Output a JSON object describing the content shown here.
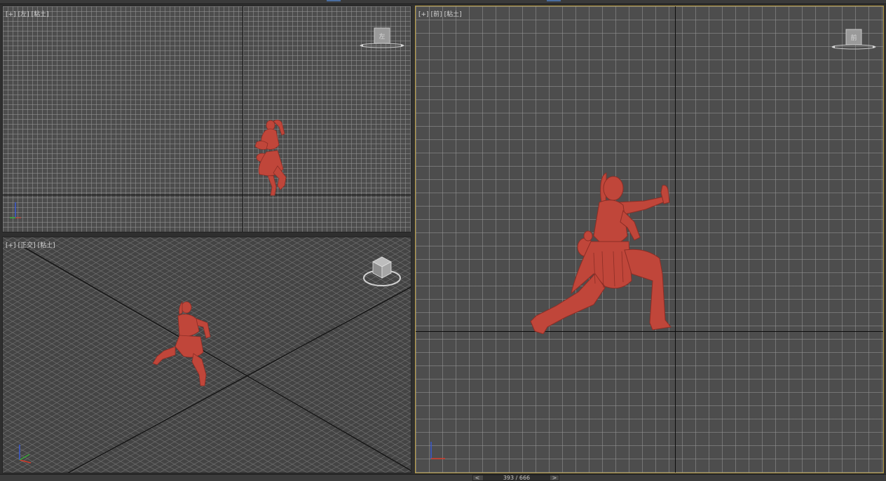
{
  "viewports": {
    "left": {
      "labels": [
        "[+]",
        "[左]",
        "[粘土]"
      ],
      "cube_face": "左"
    },
    "perspective": {
      "labels": [
        "[+]",
        "[正交]",
        "[粘土]"
      ]
    },
    "front": {
      "labels": [
        "[+]",
        "[前]",
        "[粘土]"
      ],
      "cube_face": "前"
    }
  },
  "timeline": {
    "prev": "<",
    "next": ">",
    "frame": "393 / 666",
    "current_frame": 393,
    "total_frames": 666
  },
  "colors": {
    "model": "#c0463a",
    "viewport_bg": "#4d4d4d",
    "grid_line": "#969696",
    "active_border": "#b79b40",
    "axis_x": "#d23a2a",
    "axis_y": "#3aaa3a",
    "axis_z": "#3a5ad2"
  },
  "icons": {
    "viewcube": "viewcube-icon",
    "axis_gizmo": "axis-tripod-icon",
    "model": "character-model"
  }
}
